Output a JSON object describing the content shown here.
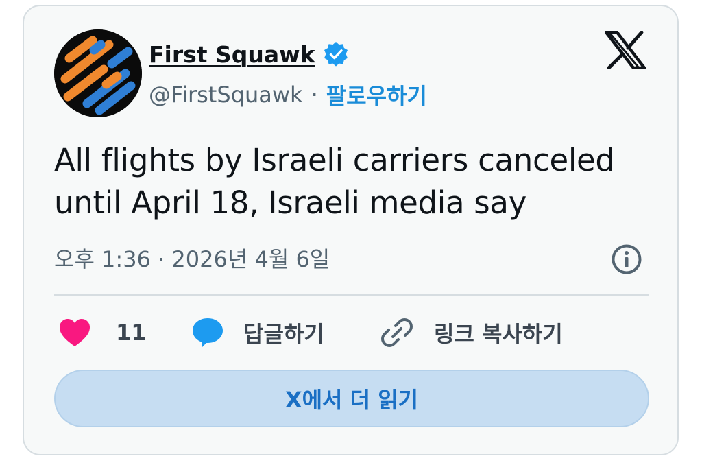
{
  "author": {
    "name": "First Squawk",
    "handle": "@FirstSquawk",
    "separator": "·",
    "follow_label": "팔로우하기",
    "verified": true
  },
  "tweet": {
    "text": "All flights by Israeli carriers canceled until April 18, Israeli media say",
    "timestamp": "오후 1:36 · 2026년 4월 6일"
  },
  "actions": {
    "like_count": "11",
    "reply_label": "답글하기",
    "copy_link_label": "링크 복사하기"
  },
  "read_more_label": "X에서 더 읽기",
  "icons": {
    "avatar": "first-squawk-logo",
    "verified": "verified-badge-icon",
    "brand": "x-logo-icon",
    "info": "info-icon",
    "like": "heart-icon",
    "reply": "speech-bubble-icon",
    "copy": "link-icon"
  },
  "colors": {
    "card_bg": "#f7f9f9",
    "border": "#d6dde1",
    "accent": "#1d9bf0",
    "heart": "#f91880",
    "button_bg": "#c6ddf2",
    "avatar_orange": "#f0892e",
    "avatar_blue": "#2f7fd6"
  }
}
